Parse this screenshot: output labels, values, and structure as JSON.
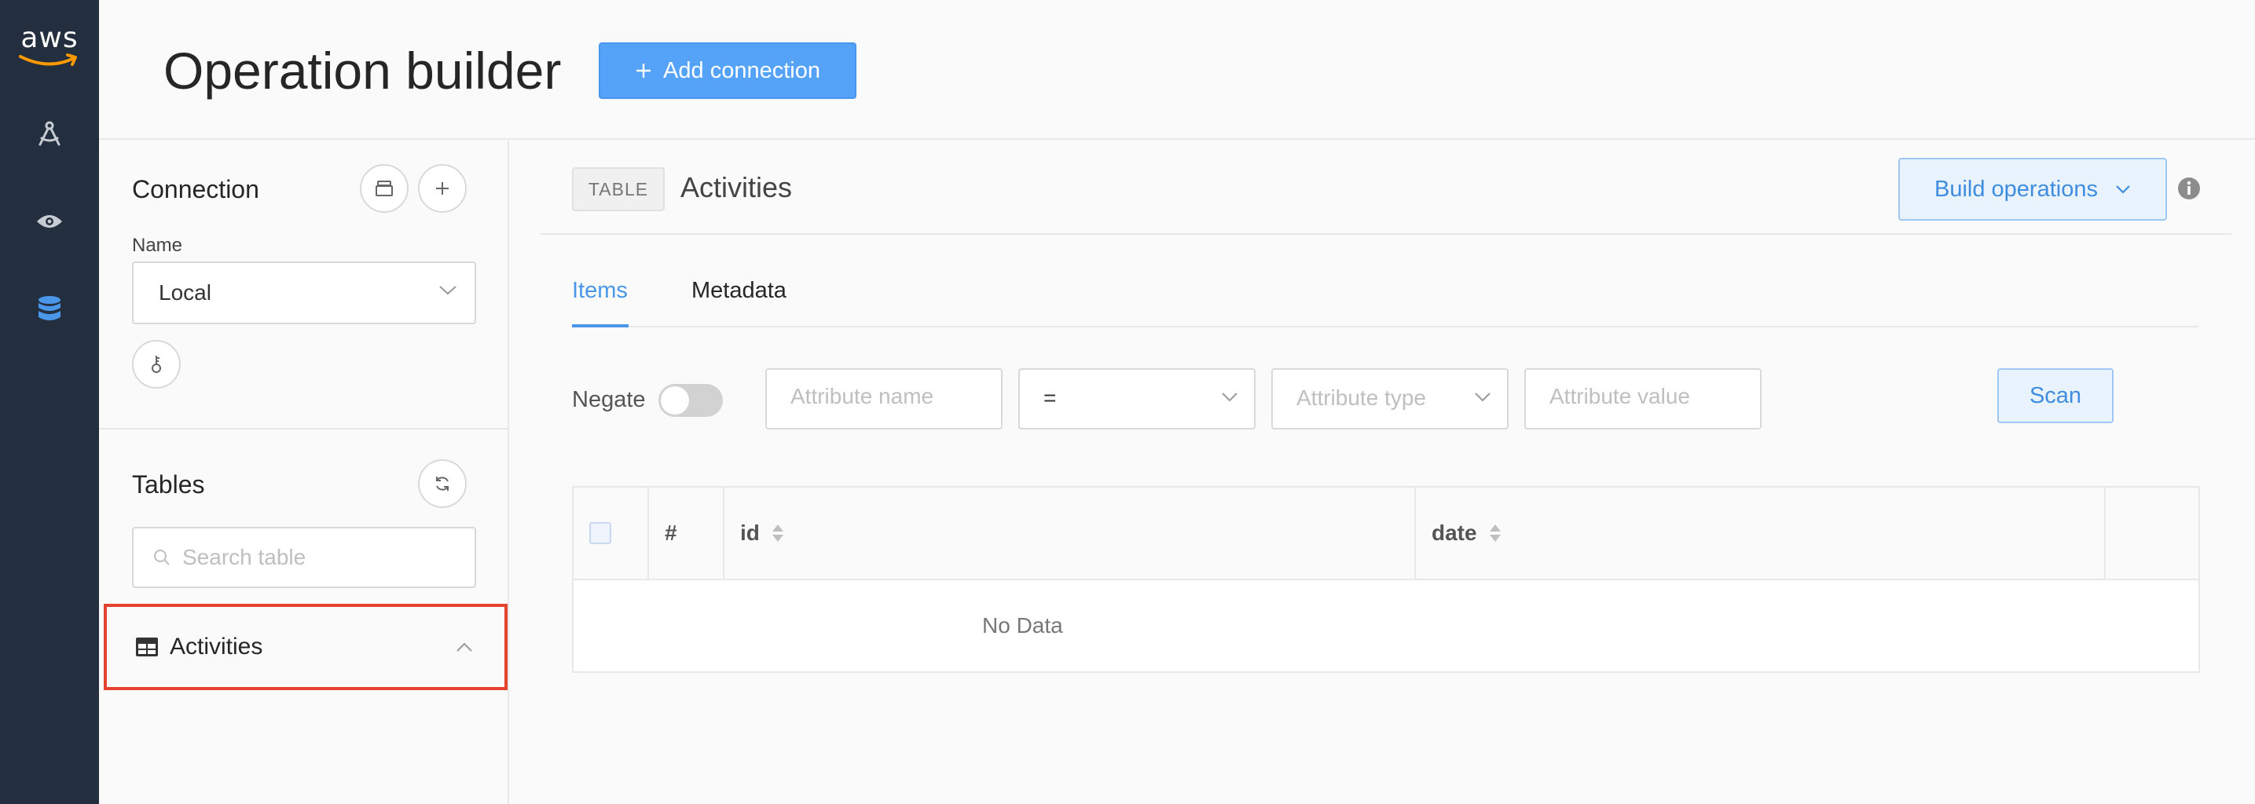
{
  "app": {
    "logo_text": "aws",
    "brand_color": "#232f3e",
    "accent_color": "#55a3f9"
  },
  "rail": {
    "items": [
      {
        "icon": "compass-tool-icon"
      },
      {
        "icon": "eye-icon"
      },
      {
        "icon": "database-icon",
        "active": true
      }
    ]
  },
  "header": {
    "title": "Operation builder",
    "add_connection_label": "Add connection"
  },
  "connection": {
    "title": "Connection",
    "name_label": "Name",
    "selected": "Local"
  },
  "tables": {
    "title": "Tables",
    "search_placeholder": "Search table",
    "items": [
      {
        "label": "Activities",
        "expanded": true,
        "highlighted": true
      }
    ]
  },
  "main": {
    "badge": "TABLE",
    "table_name": "Activities",
    "build_operations_label": "Build operations",
    "tabs": [
      {
        "label": "Items",
        "active": true
      },
      {
        "label": "Metadata",
        "active": false
      }
    ],
    "filter": {
      "negate_label": "Negate",
      "negate_on": false,
      "attribute_name_placeholder": "Attribute name",
      "operator": "=",
      "attribute_type_placeholder": "Attribute type",
      "attribute_value_placeholder": "Attribute value",
      "scan_label": "Scan"
    },
    "table": {
      "columns": [
        "#",
        "id",
        "date"
      ],
      "empty_text": "No Data"
    }
  }
}
